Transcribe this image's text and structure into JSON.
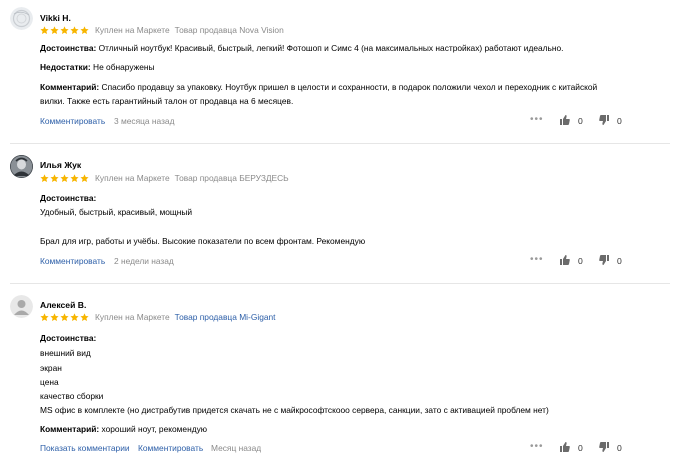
{
  "colors": {
    "star": "#f7b500",
    "link": "#2d5fa8",
    "muted": "#8a8a8a",
    "icon": "#6b6b6b"
  },
  "reviews": [
    {
      "author": "Vikki H.",
      "rating": 5,
      "bought": "Куплен на Маркете",
      "seller": "Товар продавца Nova Vision",
      "pros_label": "Достоинства:",
      "pros": "Отличный ноутбук! Красивый, быстрый, легкий! Фотошоп и Симс 4 (на максимальных настройках) работают идеально.",
      "cons_label": "Недостатки:",
      "cons": "Не обнаружены",
      "comment_label": "Комментарий:",
      "comment_line1": "Спасибо продавцу за упаковку. Ноутбук пришел в целости и сохранности, в подарок положили чехол и переходник с китайской",
      "comment_line2": "вилки. Также есть гарантийный талон от продавца на 6 месяцев.",
      "comment_link": "Комментировать",
      "date": "3 месяца назад",
      "likes": "0",
      "dislikes": "0"
    },
    {
      "author": "Илья Жук",
      "rating": 5,
      "bought": "Куплен на Маркете",
      "seller": "Товар продавца БЕРУЗДЕСЬ",
      "pros_label": "Достоинства:",
      "pros_line1": "Удобный, быстрый, красивый, мощный",
      "pros_line2": "Брал для игр, работы и учёбы. Высокие показатели по всем фронтам. Рекомендую",
      "comment_link": "Комментировать",
      "date": "2 недели назад",
      "likes": "0",
      "dislikes": "0"
    },
    {
      "author": "Алексей В.",
      "rating": 5,
      "bought": "Куплен на Маркете",
      "seller": "Товар продавца Mi-Gigant",
      "pros_label": "Достоинства:",
      "pros_items": [
        "внешний вид",
        "экран",
        "цена",
        "качество сборки",
        "MS офис в комплекте (но дистрабутив придется скачать не с майкрософтскоoo сервера, санкции, зато с активацией проблем нет)"
      ],
      "comment_label": "Комментарий:",
      "comment": "хороший ноут, рекомендую",
      "show_comments_link": "Показать комментарии",
      "comment_link": "Комментировать",
      "date": "Месяц назад",
      "likes": "0",
      "dislikes": "0"
    }
  ]
}
